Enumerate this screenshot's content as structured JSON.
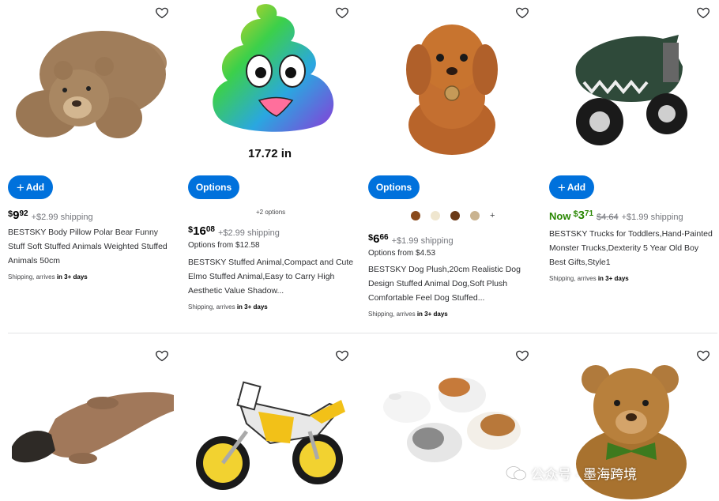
{
  "products": [
    {
      "button": "Add",
      "price": {
        "currency": "$",
        "dollars": "9",
        "cents": "92"
      },
      "shipping": "+$2.99 shipping",
      "title": "BESTSKY Body Pillow Polar Bear Funny Stuff Soft Stuffed Animals Weighted Stuffed Animals 50cm",
      "shipping_prefix": "Shipping, arrives",
      "shipping_days": "in 3+ days"
    },
    {
      "button": "Options",
      "image_caption": "17.72 in",
      "more_options": "+2 options",
      "price": {
        "currency": "$",
        "dollars": "16",
        "cents": "08"
      },
      "shipping": "+$2.99 shipping",
      "options_from": "Options from $12.58",
      "title": "BESTSKY Stuffed Animal,Compact and Cute Elmo Stuffed Animal,Easy to Carry High Aesthetic Value Shadow...",
      "shipping_prefix": "Shipping, arrives",
      "shipping_days": "in 3+ days"
    },
    {
      "button": "Options",
      "swatch_more": "+",
      "price": {
        "currency": "$",
        "dollars": "6",
        "cents": "66"
      },
      "shipping": "+$1.99 shipping",
      "options_from": "Options from $4.53",
      "title": "BESTSKY Dog Plush,20cm Realistic Dog Design Stuffed Animal Dog,Soft Plush Comfortable Feel Dog Stuffed...",
      "shipping_prefix": "Shipping, arrives",
      "shipping_days": "in 3+ days"
    },
    {
      "button": "Add",
      "price": {
        "now": "Now",
        "currency": "$",
        "dollars": "3",
        "cents": "71",
        "was": "$4.64"
      },
      "shipping": "+$1.99 shipping",
      "title": "BESTSKY Trucks for Toddlers,Hand-Painted Monster Trucks,Dexterity 5 Year Old Boy Best Gifts,Style1",
      "shipping_prefix": "Shipping, arrives",
      "shipping_days": "in 3+ days"
    }
  ],
  "watermark": "公众号 · 墨海跨境",
  "colors": {
    "accent": "#0071dc",
    "sale": "#2a8703",
    "muted": "#74767c"
  }
}
